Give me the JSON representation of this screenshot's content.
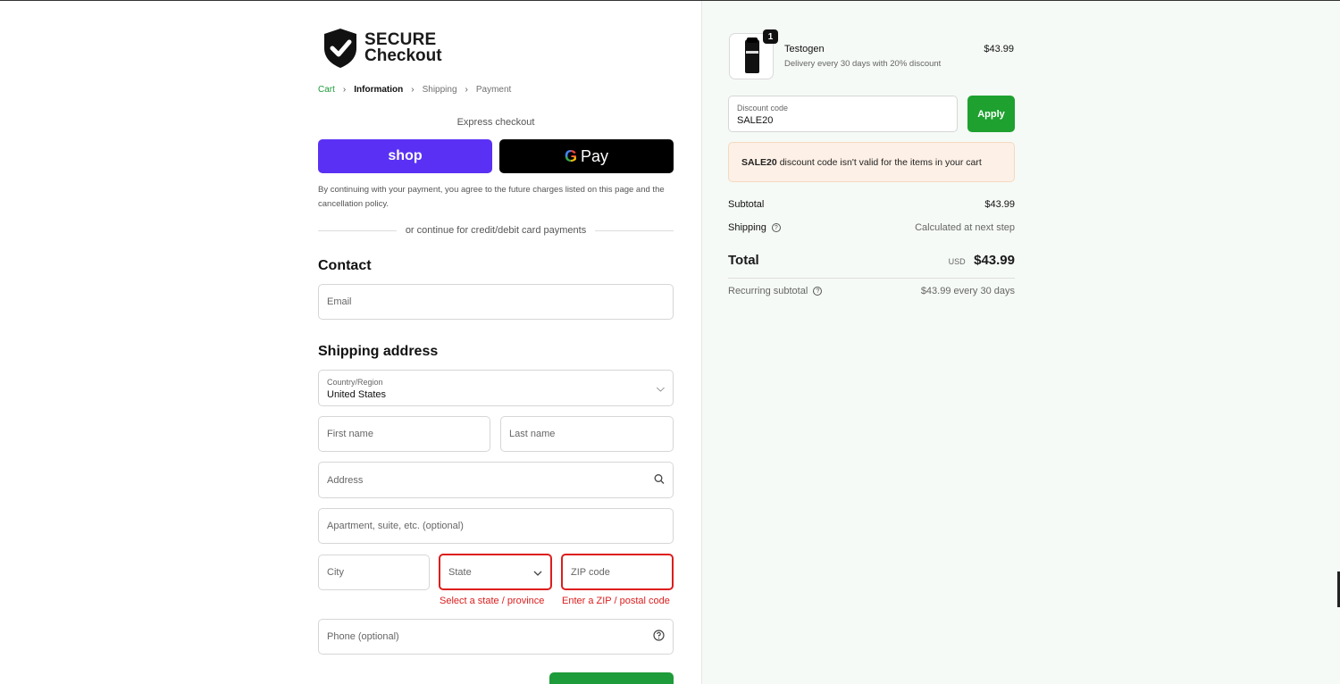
{
  "logo": {
    "line1": "SECURE",
    "line2": "Checkout"
  },
  "breadcrumb": [
    {
      "label": "Cart"
    },
    {
      "label": "Information"
    },
    {
      "label": "Shipping"
    },
    {
      "label": "Payment"
    }
  ],
  "express": {
    "title": "Express checkout",
    "shop_label": "shop",
    "gpay_g": "G",
    "gpay_label": "Pay",
    "terms": "By continuing with your payment, you agree to the future charges listed on this page and the cancellation policy.",
    "divider": "or continue for credit/debit card payments"
  },
  "contact": {
    "heading": "Contact",
    "email_placeholder": "Email"
  },
  "shipping": {
    "heading": "Shipping address",
    "country_label": "Country/Region",
    "country_value": "United States",
    "first_name": "First name",
    "last_name": "Last name",
    "address": "Address",
    "apartment": "Apartment, suite, etc. (optional)",
    "city": "City",
    "state": "State",
    "zip": "ZIP code",
    "state_error": "Select a state / province",
    "zip_error": "Enter a ZIP / postal code",
    "phone": "Phone (optional)"
  },
  "summary": {
    "quantity": "1",
    "product_name": "Testogen",
    "product_sub": "Delivery every 30 days with 20% discount",
    "product_price": "$43.99",
    "discount_label": "Discount code",
    "discount_value": "SALE20",
    "apply_label": "Apply",
    "alert_code": "SALE20",
    "alert_text": "discount code isn't valid for the items in your cart",
    "subtotal_label": "Subtotal",
    "subtotal_value": "$43.99",
    "shipping_label": "Shipping",
    "shipping_value": "Calculated at next step",
    "total_label": "Total",
    "total_currency": "USD",
    "total_value": "$43.99",
    "recurring_label": "Recurring subtotal",
    "recurring_value": "$43.99 every 30 days"
  },
  "colors": {
    "accent_green": "#1e9b3a",
    "shop_purple": "#5a31f4",
    "error_red": "#dd1d1d"
  }
}
